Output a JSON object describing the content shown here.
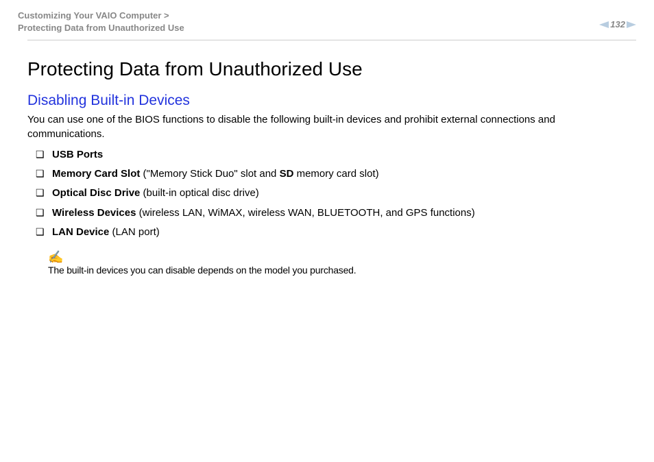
{
  "header": {
    "breadcrumb_line1": "Customizing Your VAIO Computer >",
    "breadcrumb_line2": "Protecting Data from Unauthorized Use",
    "page_number": "132"
  },
  "main": {
    "title": "Protecting Data from Unauthorized Use",
    "section_title": "Disabling Built-in Devices",
    "intro": "You can use one of the BIOS functions to disable the following built-in devices and prohibit external connections and communications.",
    "devices": [
      {
        "name": "USB Ports",
        "detail": ""
      },
      {
        "name": "Memory Card Slot",
        "detail_prefix": " (\"Memory Stick Duo\" slot and ",
        "detail_bold": "SD",
        "detail_suffix": " memory card slot)"
      },
      {
        "name": "Optical Disc Drive",
        "detail": " (built-in optical disc drive)"
      },
      {
        "name": "Wireless Devices",
        "detail": " (wireless LAN, WiMAX, wireless WAN, BLUETOOTH, and GPS functions)"
      },
      {
        "name": " LAN Device",
        "detail": " (LAN port)"
      }
    ],
    "note_icon": "✍",
    "note_text": "The built-in devices you can disable depends on the model you purchased."
  }
}
